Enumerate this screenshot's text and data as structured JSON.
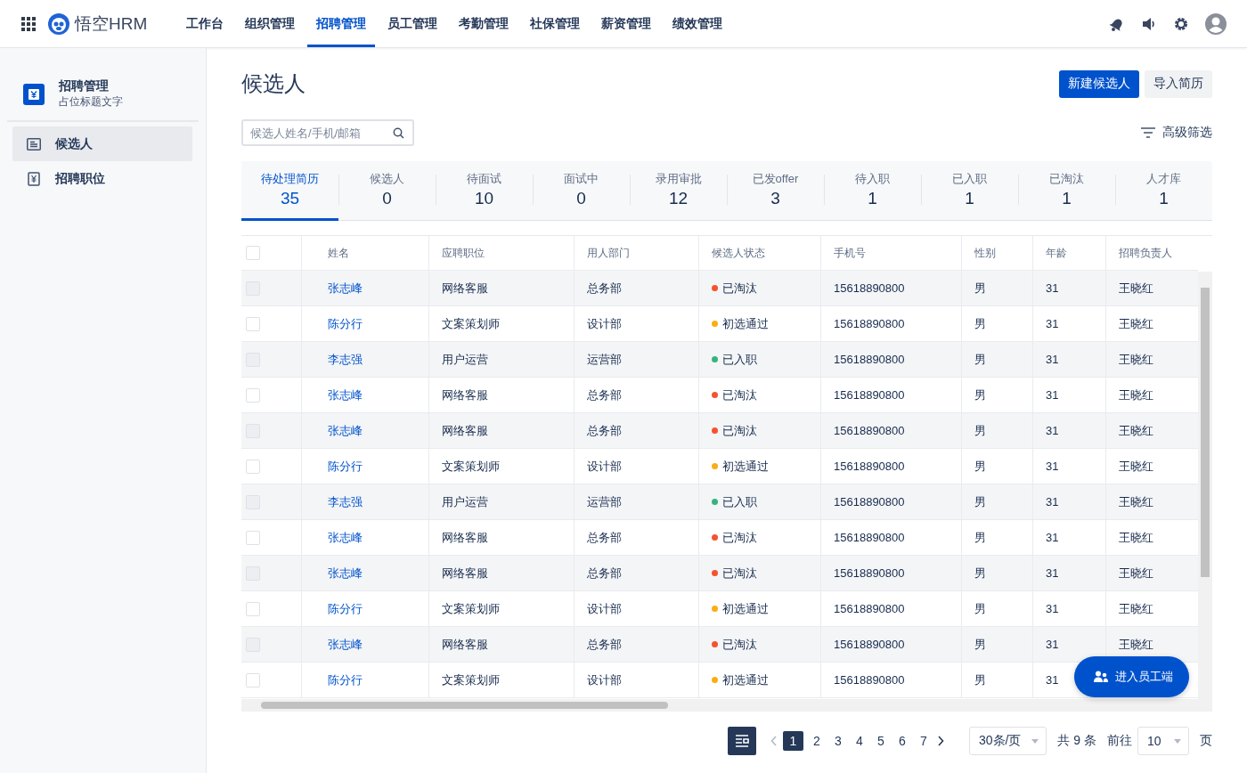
{
  "header": {
    "brand": "悟空HRM",
    "nav": [
      {
        "label": "工作台",
        "selected": false
      },
      {
        "label": "组织管理",
        "selected": false
      },
      {
        "label": "招聘管理",
        "selected": true
      },
      {
        "label": "员工管理",
        "selected": false
      },
      {
        "label": "考勤管理",
        "selected": false
      },
      {
        "label": "社保管理",
        "selected": false
      },
      {
        "label": "薪资管理",
        "selected": false
      },
      {
        "label": "绩效管理",
        "selected": false
      }
    ]
  },
  "sidebar": {
    "title": "招聘管理",
    "subtitle": "占位标题文字",
    "items": [
      {
        "label": "候选人",
        "selected": true,
        "kind": "list"
      },
      {
        "label": "招聘职位",
        "selected": false,
        "kind": "money"
      }
    ]
  },
  "page": {
    "title": "候选人",
    "buttons": [
      {
        "label": "新建候选人",
        "kind": "primary"
      },
      {
        "label": "导入简历",
        "kind": "secondary"
      }
    ],
    "search": {
      "placeholder": "候选人姓名/手机/邮箱"
    },
    "filter": "高级筛选"
  },
  "stats": [
    {
      "label": "待处理简历",
      "count": "35",
      "selected": true
    },
    {
      "label": "候选人",
      "count": "0",
      "selected": false
    },
    {
      "label": "待面试",
      "count": "10",
      "selected": false
    },
    {
      "label": "面试中",
      "count": "0",
      "selected": false
    },
    {
      "label": "录用审批",
      "count": "12",
      "selected": false
    },
    {
      "label": "已发offer",
      "count": "3",
      "selected": false
    },
    {
      "label": "待入职",
      "count": "1",
      "selected": false
    },
    {
      "label": "已入职",
      "count": "1",
      "selected": false
    },
    {
      "label": "已淘汰",
      "count": "1",
      "selected": false
    },
    {
      "label": "人才库",
      "count": "1",
      "selected": false
    }
  ],
  "table": {
    "all_checked": false,
    "columns": [
      "姓名",
      "应聘职位",
      "用人部门",
      "候选人状态",
      "手机号",
      "性别",
      "年龄",
      "招聘负责人"
    ],
    "rows": [
      {
        "checked": false,
        "name": "张志峰",
        "position": "网络客服",
        "department": "总务部",
        "status": "已淘汰",
        "color": "#f5522d",
        "phone": "15618890800",
        "gender": "男",
        "age": "31",
        "recruiter": "王晓红"
      },
      {
        "checked": false,
        "name": "陈分行",
        "position": "文案策划师",
        "department": "设计部",
        "status": "初选通过",
        "color": "#faad14",
        "phone": "15618890800",
        "gender": "男",
        "age": "31",
        "recruiter": "王晓红"
      },
      {
        "checked": false,
        "name": "李志强",
        "position": "用户运营",
        "department": "运营部",
        "status": "已入职",
        "color": "#36b37e",
        "phone": "15618890800",
        "gender": "男",
        "age": "31",
        "recruiter": "王晓红"
      },
      {
        "checked": false,
        "name": "张志峰",
        "position": "网络客服",
        "department": "总务部",
        "status": "已淘汰",
        "color": "#f5522d",
        "phone": "15618890800",
        "gender": "男",
        "age": "31",
        "recruiter": "王晓红"
      },
      {
        "checked": false,
        "name": "张志峰",
        "position": "网络客服",
        "department": "总务部",
        "status": "已淘汰",
        "color": "#f5522d",
        "phone": "15618890800",
        "gender": "男",
        "age": "31",
        "recruiter": "王晓红"
      },
      {
        "checked": false,
        "name": "陈分行",
        "position": "文案策划师",
        "department": "设计部",
        "status": "初选通过",
        "color": "#faad14",
        "phone": "15618890800",
        "gender": "男",
        "age": "31",
        "recruiter": "王晓红"
      },
      {
        "checked": false,
        "name": "李志强",
        "position": "用户运营",
        "department": "运营部",
        "status": "已入职",
        "color": "#36b37e",
        "phone": "15618890800",
        "gender": "男",
        "age": "31",
        "recruiter": "王晓红"
      },
      {
        "checked": false,
        "name": "张志峰",
        "position": "网络客服",
        "department": "总务部",
        "status": "已淘汰",
        "color": "#f5522d",
        "phone": "15618890800",
        "gender": "男",
        "age": "31",
        "recruiter": "王晓红"
      },
      {
        "checked": false,
        "name": "张志峰",
        "position": "网络客服",
        "department": "总务部",
        "status": "已淘汰",
        "color": "#f5522d",
        "phone": "15618890800",
        "gender": "男",
        "age": "31",
        "recruiter": "王晓红"
      },
      {
        "checked": false,
        "name": "陈分行",
        "position": "文案策划师",
        "department": "设计部",
        "status": "初选通过",
        "color": "#faad14",
        "phone": "15618890800",
        "gender": "男",
        "age": "31",
        "recruiter": "王晓红"
      },
      {
        "checked": false,
        "name": "张志峰",
        "position": "网络客服",
        "department": "总务部",
        "status": "已淘汰",
        "color": "#f5522d",
        "phone": "15618890800",
        "gender": "男",
        "age": "31",
        "recruiter": "王晓红"
      },
      {
        "checked": false,
        "name": "陈分行",
        "position": "文案策划师",
        "department": "设计部",
        "status": "初选通过",
        "color": "#faad14",
        "phone": "15618890800",
        "gender": "男",
        "age": "31"
      }
    ]
  },
  "floating_button": "进入员工端",
  "pagination": {
    "pages": [
      {
        "label": "1",
        "selected": true
      },
      {
        "label": "2",
        "selected": false
      },
      {
        "label": "3",
        "selected": false
      },
      {
        "label": "4",
        "selected": false
      },
      {
        "label": "5",
        "selected": false
      },
      {
        "label": "6",
        "selected": false
      },
      {
        "label": "7",
        "selected": false
      }
    ],
    "page_size": "30条/页",
    "total": "共 9 条",
    "goto_label": "前往",
    "goto_value": "10",
    "unit": "页"
  }
}
